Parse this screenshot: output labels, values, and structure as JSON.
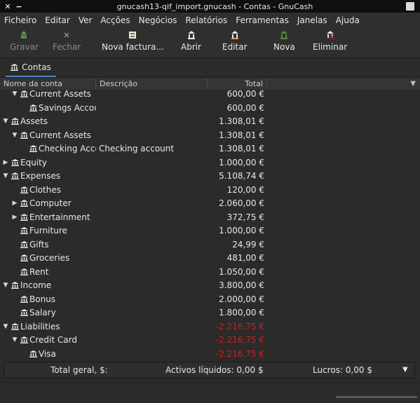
{
  "window": {
    "title": "gnucash13-qif_import.gnucash - Contas - GnuCash"
  },
  "menu": [
    "Ficheiro",
    "Editar",
    "Ver",
    "Acções",
    "Negócios",
    "Relatórios",
    "Ferramentas",
    "Janelas",
    "Ajuda"
  ],
  "toolbar": {
    "save": "Gravar",
    "close": "Fechar",
    "new_invoice": "Nova factura...",
    "open": "Abrir",
    "edit": "Editar",
    "new": "Nova",
    "delete": "Eliminar"
  },
  "tab": {
    "label": "Contas"
  },
  "columns": {
    "name": "Nome da conta",
    "description": "Descrição",
    "total": "Total"
  },
  "rows": [
    {
      "name": "Current Assets",
      "description": "",
      "total": "600,00 €",
      "negative": false,
      "level": 1,
      "expander": "open"
    },
    {
      "name": "Savings Account",
      "description": "",
      "total": "600,00 €",
      "negative": false,
      "level": 2,
      "expander": "none"
    },
    {
      "name": "Assets",
      "description": "",
      "total": "1.308,01 €",
      "negative": false,
      "level": 0,
      "expander": "open"
    },
    {
      "name": "Current Assets",
      "description": "",
      "total": "1.308,01 €",
      "negative": false,
      "level": 1,
      "expander": "open"
    },
    {
      "name": "Checking Account",
      "description": "Checking account",
      "total": "1.308,01 €",
      "negative": false,
      "level": 2,
      "expander": "none"
    },
    {
      "name": "Equity",
      "description": "",
      "total": "1.000,00 €",
      "negative": false,
      "level": 0,
      "expander": "closed"
    },
    {
      "name": "Expenses",
      "description": "",
      "total": "5.108,74 €",
      "negative": false,
      "level": 0,
      "expander": "open"
    },
    {
      "name": "Clothes",
      "description": "",
      "total": "120,00 €",
      "negative": false,
      "level": 1,
      "expander": "none"
    },
    {
      "name": "Computer",
      "description": "",
      "total": "2.060,00 €",
      "negative": false,
      "level": 1,
      "expander": "closed"
    },
    {
      "name": "Entertainment",
      "description": "",
      "total": "372,75 €",
      "negative": false,
      "level": 1,
      "expander": "closed"
    },
    {
      "name": "Furniture",
      "description": "",
      "total": "1.000,00 €",
      "negative": false,
      "level": 1,
      "expander": "none"
    },
    {
      "name": "Gifts",
      "description": "",
      "total": "24,99 €",
      "negative": false,
      "level": 1,
      "expander": "none"
    },
    {
      "name": "Groceries",
      "description": "",
      "total": "481,00 €",
      "negative": false,
      "level": 1,
      "expander": "none"
    },
    {
      "name": "Rent",
      "description": "",
      "total": "1.050,00 €",
      "negative": false,
      "level": 1,
      "expander": "none"
    },
    {
      "name": "Income",
      "description": "",
      "total": "3.800,00 €",
      "negative": false,
      "level": 0,
      "expander": "open"
    },
    {
      "name": "Bonus",
      "description": "",
      "total": "2.000,00 €",
      "negative": false,
      "level": 1,
      "expander": "none"
    },
    {
      "name": "Salary",
      "description": "",
      "total": "1.800,00 €",
      "negative": false,
      "level": 1,
      "expander": "none"
    },
    {
      "name": "Liabilities",
      "description": "",
      "total": "-2.216,75 €",
      "negative": true,
      "level": 0,
      "expander": "open"
    },
    {
      "name": "Credit Card",
      "description": "",
      "total": "-2.216,75 €",
      "negative": true,
      "level": 1,
      "expander": "open"
    },
    {
      "name": "Visa",
      "description": "",
      "total": "-2.216,75 €",
      "negative": true,
      "level": 2,
      "expander": "none"
    }
  ],
  "summary": {
    "label": "Total geral, $:",
    "net_assets": "Activos líquidos: 0,00 $",
    "profits": "Lucros: 0,00 $"
  },
  "colors": {
    "negative": "#cc2222",
    "tab_underline": "#4a86c8",
    "background": "#2b2b2b"
  }
}
